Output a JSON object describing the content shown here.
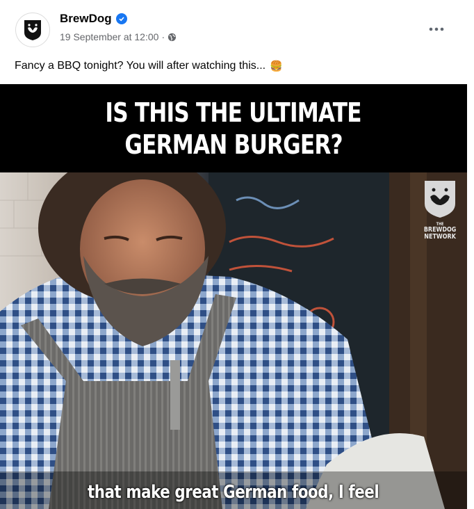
{
  "post": {
    "page_name": "BrewDog",
    "timestamp": "19 September at 12:00",
    "separator": "·",
    "caption": "Fancy a BBQ tonight? You will after watching this...",
    "caption_emoji": "🍔",
    "icons": {
      "avatar": "brewdog-logo-icon",
      "verified": "verified-badge-icon",
      "audience": "globe-icon",
      "more": "more-options-icon"
    }
  },
  "video": {
    "title_lines": [
      "IS THIS THE ULTIMATE",
      "GERMAN BURGER?"
    ],
    "watermark_text": [
      "THE",
      "BREWDOG",
      "NETWORK"
    ],
    "subtitle": "that make great German food, I feel"
  },
  "colors": {
    "verified_blue": "#1877f2",
    "meta_gray": "#65676b",
    "title_band": "#000000"
  }
}
